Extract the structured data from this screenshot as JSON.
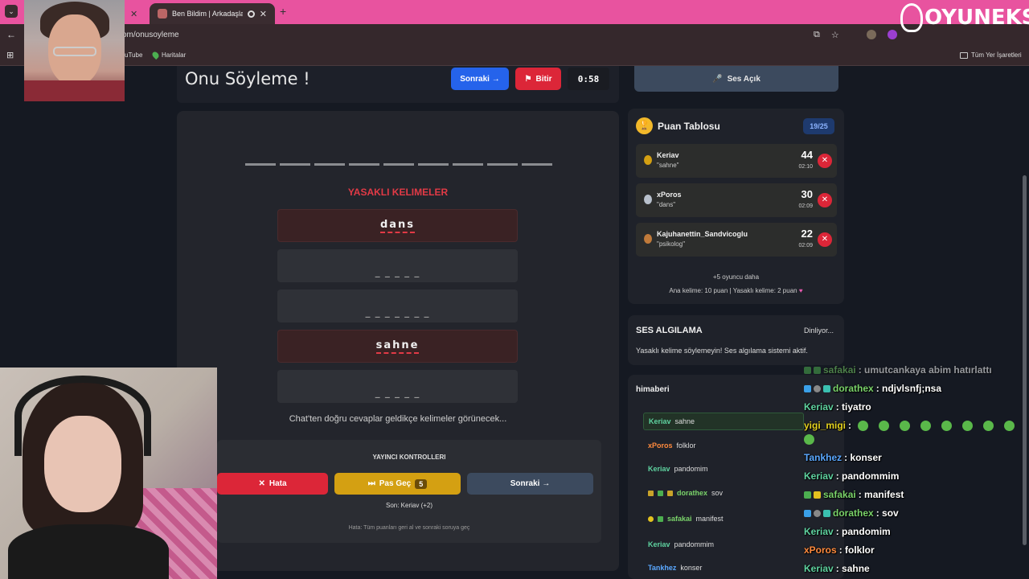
{
  "browser": {
    "tab_menu_icon": "chevron-down-icon",
    "active_tab_title": "Ben Bildim | Arkadaşlarınla",
    "url": "om/onusoyleme",
    "bookmarks": [
      "uTube",
      "Haritalar"
    ],
    "bookmarks_right": "Tüm Yer İşaretleri"
  },
  "logo": {
    "text": "OYUNEKS"
  },
  "game": {
    "title": "Onu Söyleme !",
    "next_label": "Sonraki →",
    "finish_label": "Bitir",
    "timer": "0:58",
    "sound_label": "Ses Açık",
    "forbidden_title": "YASAKLI KELIMELER",
    "forbidden_words": [
      {
        "text": "dans",
        "revealed": true
      },
      {
        "text": "_ _ _ _ _",
        "revealed": false
      },
      {
        "text": "_ _ _ _ _ _ _",
        "revealed": false
      },
      {
        "text": "sahne",
        "revealed": true
      },
      {
        "text": "_ _ _ _ _",
        "revealed": false
      }
    ],
    "hint": "Chat'ten doğru cevaplar geldikçe kelimeler görünecek..."
  },
  "controls": {
    "title": "YAYINCI KONTROLLERI",
    "error_label": "Hata",
    "pass_label": "Pas Geç",
    "pass_count": "5",
    "next_label": "Sonraki →",
    "last": "Son: Keriav (+2)",
    "note": "Hata: Tüm puanları geri al ve sonraki soruya geç"
  },
  "scoreboard": {
    "title": "Puan Tablosu",
    "count": "19/25",
    "players": [
      {
        "name": "Keriav",
        "word": "\"sahne\"",
        "points": "44",
        "time": "02:10",
        "medal": "#d4a012"
      },
      {
        "name": "xPoros",
        "word": "\"dans\"",
        "points": "30",
        "time": "02:09",
        "medal": "#b8c0cc"
      },
      {
        "name": "Kajuhanettin_Sandvicoglu",
        "word": "\"psikolog\"",
        "points": "22",
        "time": "02:09",
        "medal": "#c07a3a"
      }
    ],
    "more": "+5 oyuncu daha",
    "rules": "Ana kelime: 10 puan | Yasaklı kelime: 2 puan"
  },
  "voice": {
    "title": "SES ALGILAMA",
    "status": "Dinliyor...",
    "message": "Yasaklı kelime söylemeyin! Ses algılama sistemi aktif."
  },
  "chat": {
    "channel": "himaberi",
    "messages": [
      {
        "user": "Keriav",
        "text": "sahne",
        "color": "#5fd3a0",
        "highlight": true
      },
      {
        "user": "xPoros",
        "text": "folklor",
        "color": "#ff8a3d",
        "highlight": false
      },
      {
        "user": "Keriav",
        "text": "pandomim",
        "color": "#5fd3a0",
        "highlight": false
      },
      {
        "user": "dorathex",
        "text": "sov",
        "color": "#7ad36a",
        "highlight": false
      },
      {
        "user": "safakai",
        "text": "manifest",
        "color": "#7ad36a",
        "highlight": false
      },
      {
        "user": "Keriav",
        "text": "pandommim",
        "color": "#5fd3a0",
        "highlight": false
      },
      {
        "user": "Tankhez",
        "text": "konser",
        "color": "#5aa8ff",
        "highlight": false
      }
    ]
  },
  "overlay_chat": [
    {
      "user": "safakai",
      "text": ": umutcankaya abim hatırlattı",
      "color": "#7ad36a"
    },
    {
      "user": "dorathex",
      "text": ": ndjvlsnfj;nsa",
      "color": "#7ad36a"
    },
    {
      "user": "Keriav",
      "text": ": tiyatro",
      "color": "#5fd3a0"
    },
    {
      "user": "yigi_migi",
      "text": ":",
      "color": "#e3d11f"
    },
    {
      "user": "Tankhez",
      "text": ": konser",
      "color": "#5aa8ff"
    },
    {
      "user": "Keriav",
      "text": ": pandommim",
      "color": "#5fd3a0"
    },
    {
      "user": "safakai",
      "text": ": manifest",
      "color": "#7ad36a"
    },
    {
      "user": "dorathex",
      "text": ": sov",
      "color": "#7ad36a"
    },
    {
      "user": "Keriav",
      "text": ": pandomim",
      "color": "#5fd3a0"
    },
    {
      "user": "xPoros",
      "text": ": folklor",
      "color": "#ff8a3d"
    },
    {
      "user": "Keriav",
      "text": ": sahne",
      "color": "#5fd3a0"
    }
  ]
}
